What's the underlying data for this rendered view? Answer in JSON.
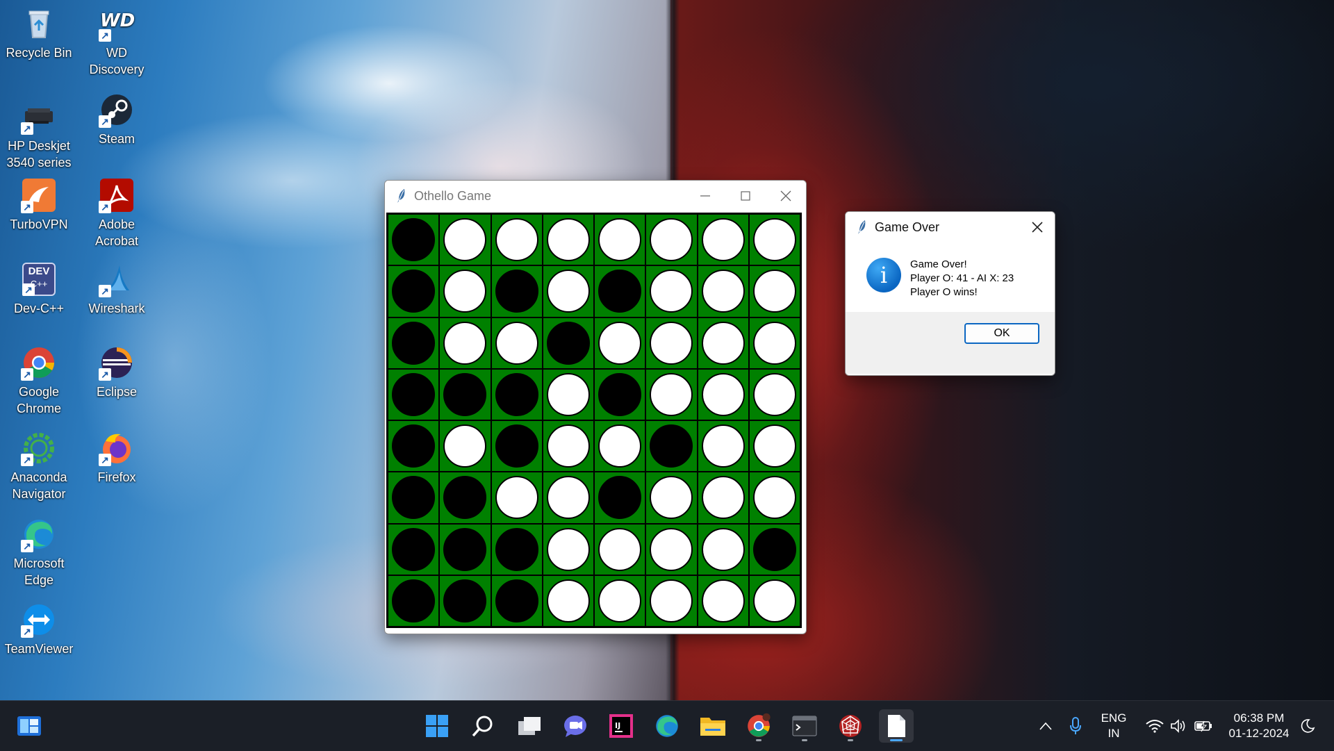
{
  "desktop": {
    "icons": [
      {
        "name": "recycle-bin",
        "label": "Recycle Bin"
      },
      {
        "name": "wd-discovery",
        "label": "WD Discovery"
      },
      {
        "name": "hp-deskjet",
        "label": "HP Deskjet 3540 series"
      },
      {
        "name": "steam",
        "label": "Steam"
      },
      {
        "name": "turbovpn",
        "label": "TurboVPN"
      },
      {
        "name": "adobe-acrobat",
        "label": "Adobe Acrobat"
      },
      {
        "name": "dev-cpp",
        "label": "Dev-C++"
      },
      {
        "name": "wireshark",
        "label": "Wireshark"
      },
      {
        "name": "google-chrome",
        "label": "Google Chrome"
      },
      {
        "name": "eclipse",
        "label": "Eclipse"
      },
      {
        "name": "anaconda-navigator",
        "label": "Anaconda Navigator"
      },
      {
        "name": "firefox",
        "label": "Firefox"
      },
      {
        "name": "microsoft-edge",
        "label": "Microsoft Edge"
      },
      {
        "name": "teamviewer",
        "label": "TeamViewer"
      }
    ]
  },
  "game_window": {
    "title": "Othello Game",
    "board": [
      [
        "B",
        "W",
        "W",
        "W",
        "W",
        "W",
        "W",
        "W"
      ],
      [
        "B",
        "W",
        "B",
        "W",
        "B",
        "W",
        "W",
        "W"
      ],
      [
        "B",
        "W",
        "W",
        "B",
        "W",
        "W",
        "W",
        "W"
      ],
      [
        "B",
        "B",
        "B",
        "W",
        "B",
        "W",
        "W",
        "W"
      ],
      [
        "B",
        "W",
        "B",
        "W",
        "W",
        "B",
        "W",
        "W"
      ],
      [
        "B",
        "B",
        "W",
        "W",
        "B",
        "W",
        "W",
        "W"
      ],
      [
        "B",
        "B",
        "B",
        "W",
        "W",
        "W",
        "W",
        "B"
      ],
      [
        "B",
        "B",
        "B",
        "W",
        "W",
        "W",
        "W",
        "W"
      ]
    ],
    "colors": {
      "board": "#008000",
      "black": "#000000",
      "white": "#ffffff"
    }
  },
  "dialog": {
    "title": "Game Over",
    "line1": "Game Over!",
    "line2": "Player O: 41 - AI X: 23",
    "line3": "Player O wins!",
    "ok_label": "OK",
    "icon": "info-icon"
  },
  "taskbar": {
    "apps": [
      "start",
      "search",
      "task-view",
      "chat",
      "intellij",
      "edge",
      "file-explorer",
      "chrome",
      "terminal",
      "network-app",
      "notepad"
    ],
    "language_line1": "ENG",
    "language_line2": "IN",
    "time": "06:38 PM",
    "date": "01-12-2024",
    "accent": "#4aa8ff"
  }
}
